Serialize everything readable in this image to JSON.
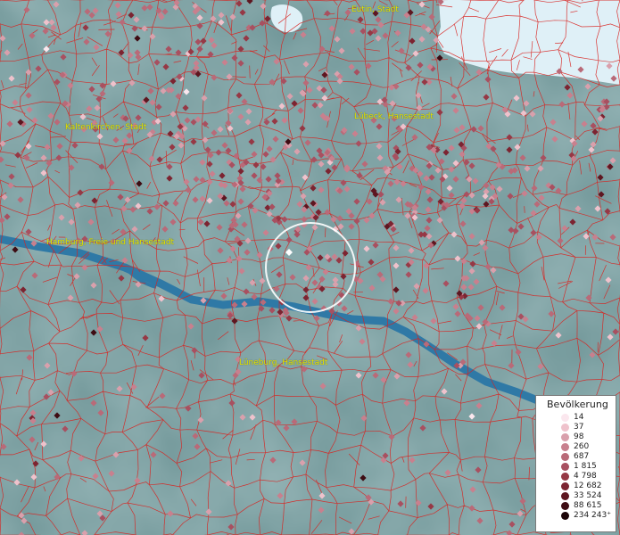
{
  "map": {
    "labels": [
      {
        "id": "eutin",
        "text": "Eutin, Stadt"
      },
      {
        "id": "luebeck",
        "text": "Lübeck, Hansestadt"
      },
      {
        "id": "kaltenkirchen",
        "text": "Kaltenkirchen, Stadt"
      },
      {
        "id": "hamburg",
        "text": "Hamburg, Freie und Hansestadt"
      },
      {
        "id": "lueneburg",
        "text": "Lüneburg, Hansestadt"
      }
    ],
    "colors": {
      "land": "#6f9597",
      "water": "#2f79a6",
      "sea": "#dff0f7",
      "boundaries": "#d8221f",
      "label_text": "#e6e600",
      "selection_ring": "#ffffff"
    }
  },
  "legend": {
    "title": "Bevölkerung",
    "classes": [
      {
        "value": "14",
        "color": "#fbe7ee"
      },
      {
        "value": "37",
        "color": "#efc2cc"
      },
      {
        "value": "98",
        "color": "#d9a0ac"
      },
      {
        "value": "260",
        "color": "#c8808e"
      },
      {
        "value": "687",
        "color": "#b96a78"
      },
      {
        "value": "1 815",
        "color": "#a85060"
      },
      {
        "value": "4 798",
        "color": "#963845"
      },
      {
        "value": "12 682",
        "color": "#7c2431"
      },
      {
        "value": "33 524",
        "color": "#5e1620"
      },
      {
        "value": "88 615",
        "color": "#3e0c13"
      },
      {
        "value": "234 243⁺",
        "color": "#1c0508"
      }
    ]
  }
}
